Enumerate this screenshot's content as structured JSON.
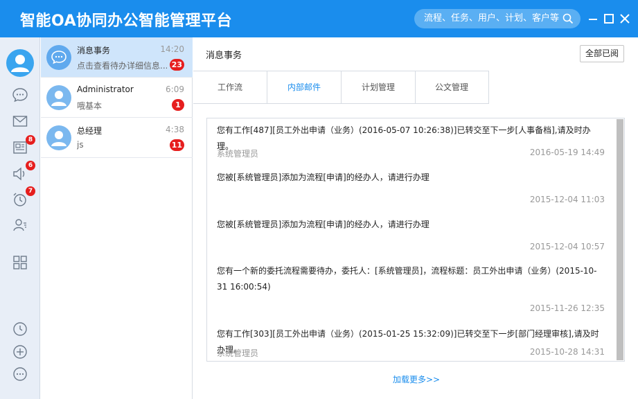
{
  "app_title": "智能OA协同办公智能管理平台",
  "search": {
    "placeholder": "流程、任务、用户、计划、客户等"
  },
  "sidebar": {
    "badges": {
      "news": "8",
      "notice": "6",
      "reminder": "7"
    }
  },
  "conversations": [
    {
      "name": "消息事务",
      "time": "14:20",
      "preview": "点击查看待办详细信息...",
      "badge": "23"
    },
    {
      "name": "Administrator",
      "time": "6:09",
      "preview": "哦基本",
      "badge": "1"
    },
    {
      "name": "总经理",
      "time": "4:38",
      "preview": "js",
      "badge": "11"
    }
  ],
  "main": {
    "title": "消息事务",
    "mark_all_read": "全部已阅",
    "tabs": [
      "工作流",
      "内部邮件",
      "计划管理",
      "公文管理"
    ],
    "load_more": "加载更多>>"
  },
  "messages": [
    {
      "text": "您有工作[487][员工外出申请（业务）(2016-05-07 10:26:38)]已转交至下一步[人事备档],请及时办理。",
      "from": "系统管理员",
      "date": "2016-05-19 14:49"
    },
    {
      "text": "您被[系统管理员]添加为流程[申请]的经办人，请进行办理",
      "from": "",
      "date": "2015-12-04 11:03"
    },
    {
      "text": "您被[系统管理员]添加为流程[申请]的经办人，请进行办理",
      "from": "",
      "date": "2015-12-04 10:57"
    },
    {
      "text": "您有一个新的委托流程需要待办，委托人：[系统管理员]，流程标题：员工外出申请（业务）(2015-10-31 16:00:54)",
      "from": "",
      "date": "2015-11-26 12:35"
    },
    {
      "text": "您有工作[303][员工外出申请（业务）(2015-01-25 15:32:09)]已转交至下一步[部门经理审核],请及时办理。",
      "from": "系统管理员",
      "date": "2015-10-28 14:31"
    }
  ],
  "colors": {
    "brand": "#1a8ded",
    "badge": "#e61e1e"
  }
}
